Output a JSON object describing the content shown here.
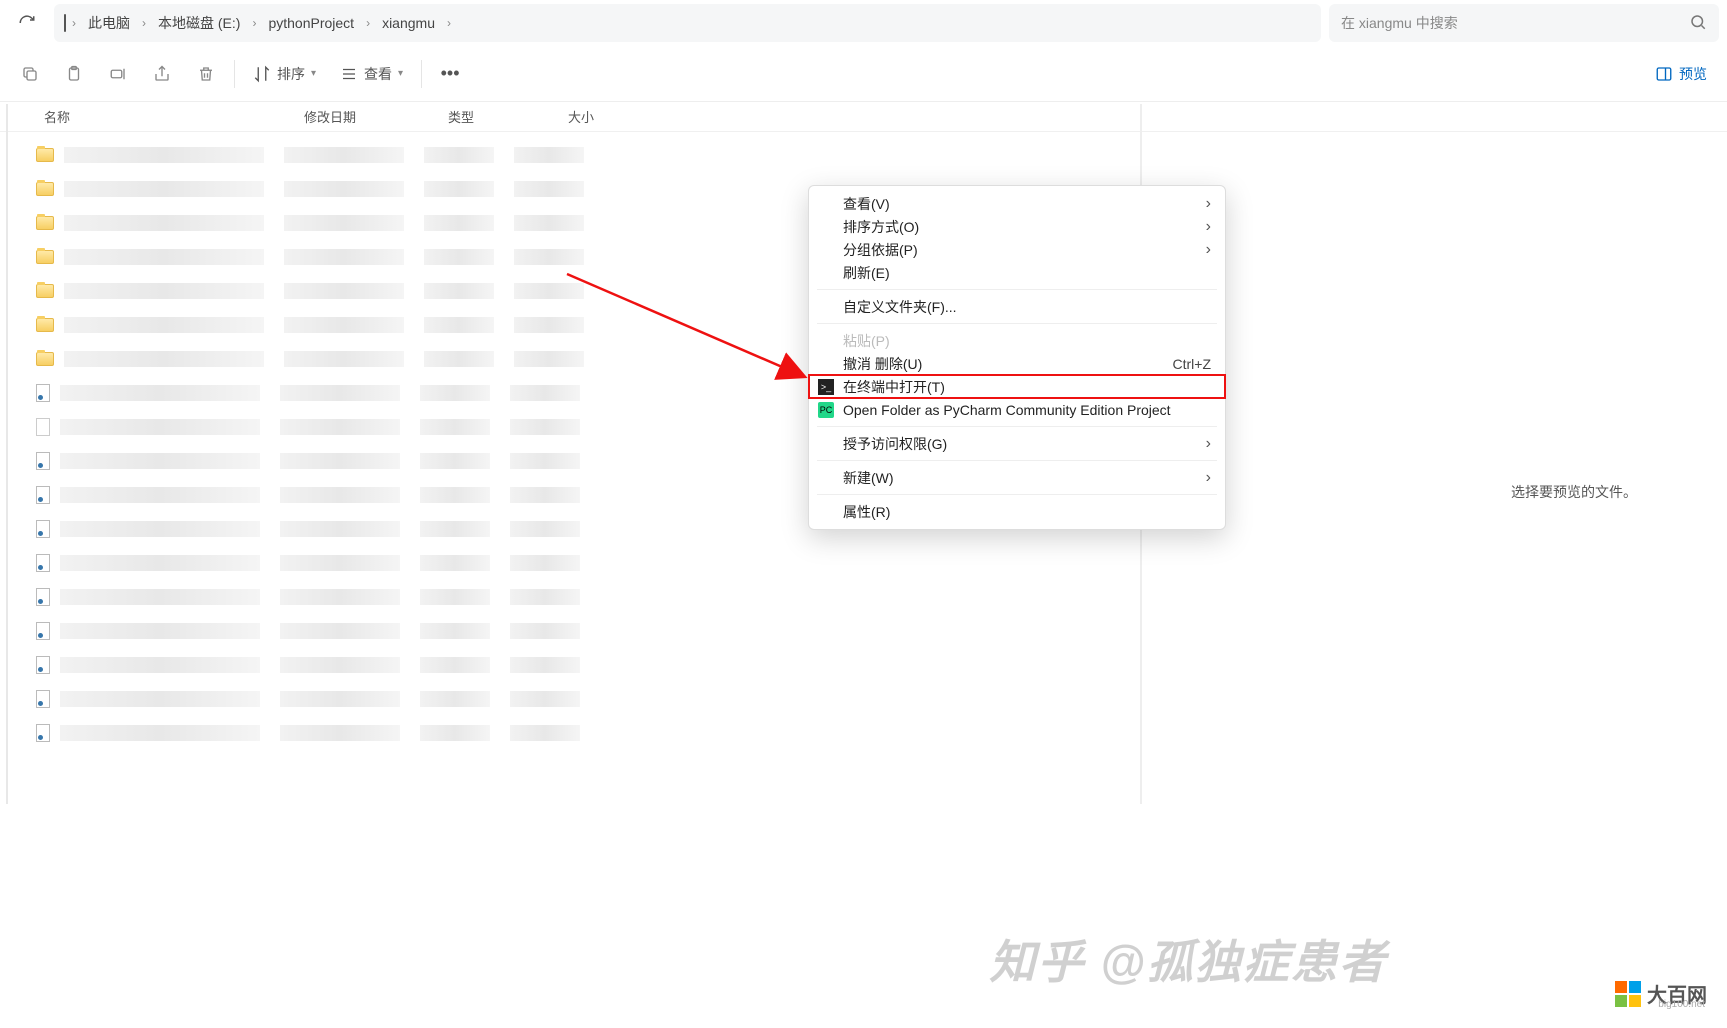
{
  "breadcrumb": {
    "segments": [
      "此电脑",
      "本地磁盘 (E:)",
      "pythonProject",
      "xiangmu"
    ]
  },
  "search": {
    "placeholder": "在 xiangmu 中搜索"
  },
  "toolbar": {
    "sort_label": "排序",
    "view_label": "查看",
    "preview_label": "预览"
  },
  "columns": {
    "name": "名称",
    "date": "修改日期",
    "type": "类型",
    "size": "大小"
  },
  "file_types": [
    "folder",
    "folder",
    "folder",
    "folder",
    "folder",
    "folder",
    "folder",
    "py",
    "txt",
    "py",
    "py",
    "py",
    "py",
    "py",
    "py",
    "py",
    "py",
    "py"
  ],
  "context_menu": {
    "view": "查看(V)",
    "sort": "排序方式(O)",
    "group": "分组依据(P)",
    "refresh": "刷新(E)",
    "custom_folder": "自定义文件夹(F)...",
    "paste": "粘贴(P)",
    "undo_delete": "撤消 删除(U)",
    "undo_shortcut": "Ctrl+Z",
    "open_terminal": "在终端中打开(T)",
    "open_pycharm": "Open Folder as PyCharm Community Edition Project",
    "grant_access": "授予访问权限(G)",
    "new": "新建(W)",
    "properties": "属性(R)"
  },
  "preview_hint": "选择要预览的文件。",
  "watermark": {
    "zhihu": "知乎 @孤独症患者",
    "big100": "大百网",
    "big100_sub": "big100.net"
  }
}
